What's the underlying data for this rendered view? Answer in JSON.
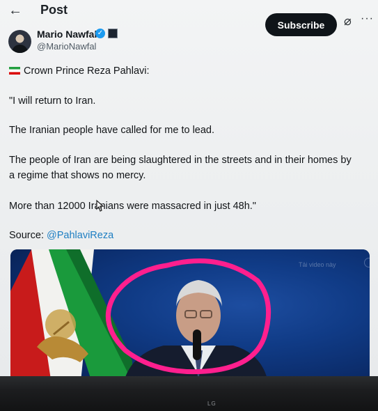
{
  "header": {
    "back_glyph": "←",
    "title": "Post"
  },
  "author": {
    "name": "Mario Nawfal",
    "handle": "@MarioNawfal",
    "verified_glyph": "✓"
  },
  "actions": {
    "subscribe_label": "Subscribe",
    "grok_glyph": "⌀",
    "more_glyph": "···"
  },
  "post": {
    "line1": "Crown Prince Reza Pahlavi:",
    "line2": "\"I will return to Iran.",
    "line3": "The Iranian people have called for me to lead.",
    "line4": "The people of Iran are being slaughtered in the streets and in their homes by a regime that shows no mercy.",
    "line5": "More than 12000 Iranians were massacred in just 48h.\"",
    "source_label": "Source:",
    "source_link": "@PahlaviReza"
  },
  "video": {
    "overlay_label": "Tải video này"
  },
  "monitor": {
    "brand": "LG"
  },
  "colors": {
    "accent": "#1d9bf0",
    "link": "#1d7ec2",
    "annotation": "#ff1f8e",
    "flag_green": "#239f40",
    "flag_red": "#da0000"
  },
  "icons": [
    "back-arrow-icon",
    "verified-icon",
    "affiliate-badge-icon",
    "grok-icon",
    "more-icon",
    "iran-flag-icon",
    "volume-icon",
    "cursor-icon"
  ]
}
